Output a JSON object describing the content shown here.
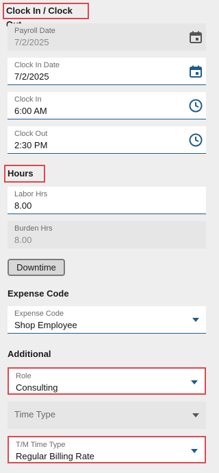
{
  "sections": {
    "clock": "Clock In / Clock Out",
    "hours": "Hours",
    "expense": "Expense Code",
    "additional": "Additional"
  },
  "fields": {
    "payroll_date": {
      "label": "Payroll Date",
      "value": "7/2/2025",
      "icon": "calendar-icon"
    },
    "clock_in_date": {
      "label": "Clock In Date",
      "value": "7/2/2025",
      "icon": "calendar-icon"
    },
    "clock_in": {
      "label": "Clock In",
      "value": "6:00 AM",
      "icon": "clock-icon"
    },
    "clock_out": {
      "label": "Clock Out",
      "value": "2:30 PM",
      "icon": "clock-icon"
    },
    "labor_hrs": {
      "label": "Labor Hrs",
      "value": "8.00"
    },
    "burden_hrs": {
      "label": "Burden Hrs",
      "value": "8.00"
    },
    "expense_code": {
      "label": "Expense Code",
      "value": "Shop Employee"
    },
    "role": {
      "label": "Role",
      "value": "Consulting"
    },
    "time_type": {
      "label": "Time Type",
      "value": ""
    },
    "tm_time_type": {
      "label": "T/M Time Type",
      "value": "Regular Billing Rate"
    }
  },
  "buttons": {
    "downtime": "Downtime"
  },
  "colors": {
    "accent": "#1d5c8f",
    "highlight": "#e0474c",
    "background": "#eeeeee"
  }
}
